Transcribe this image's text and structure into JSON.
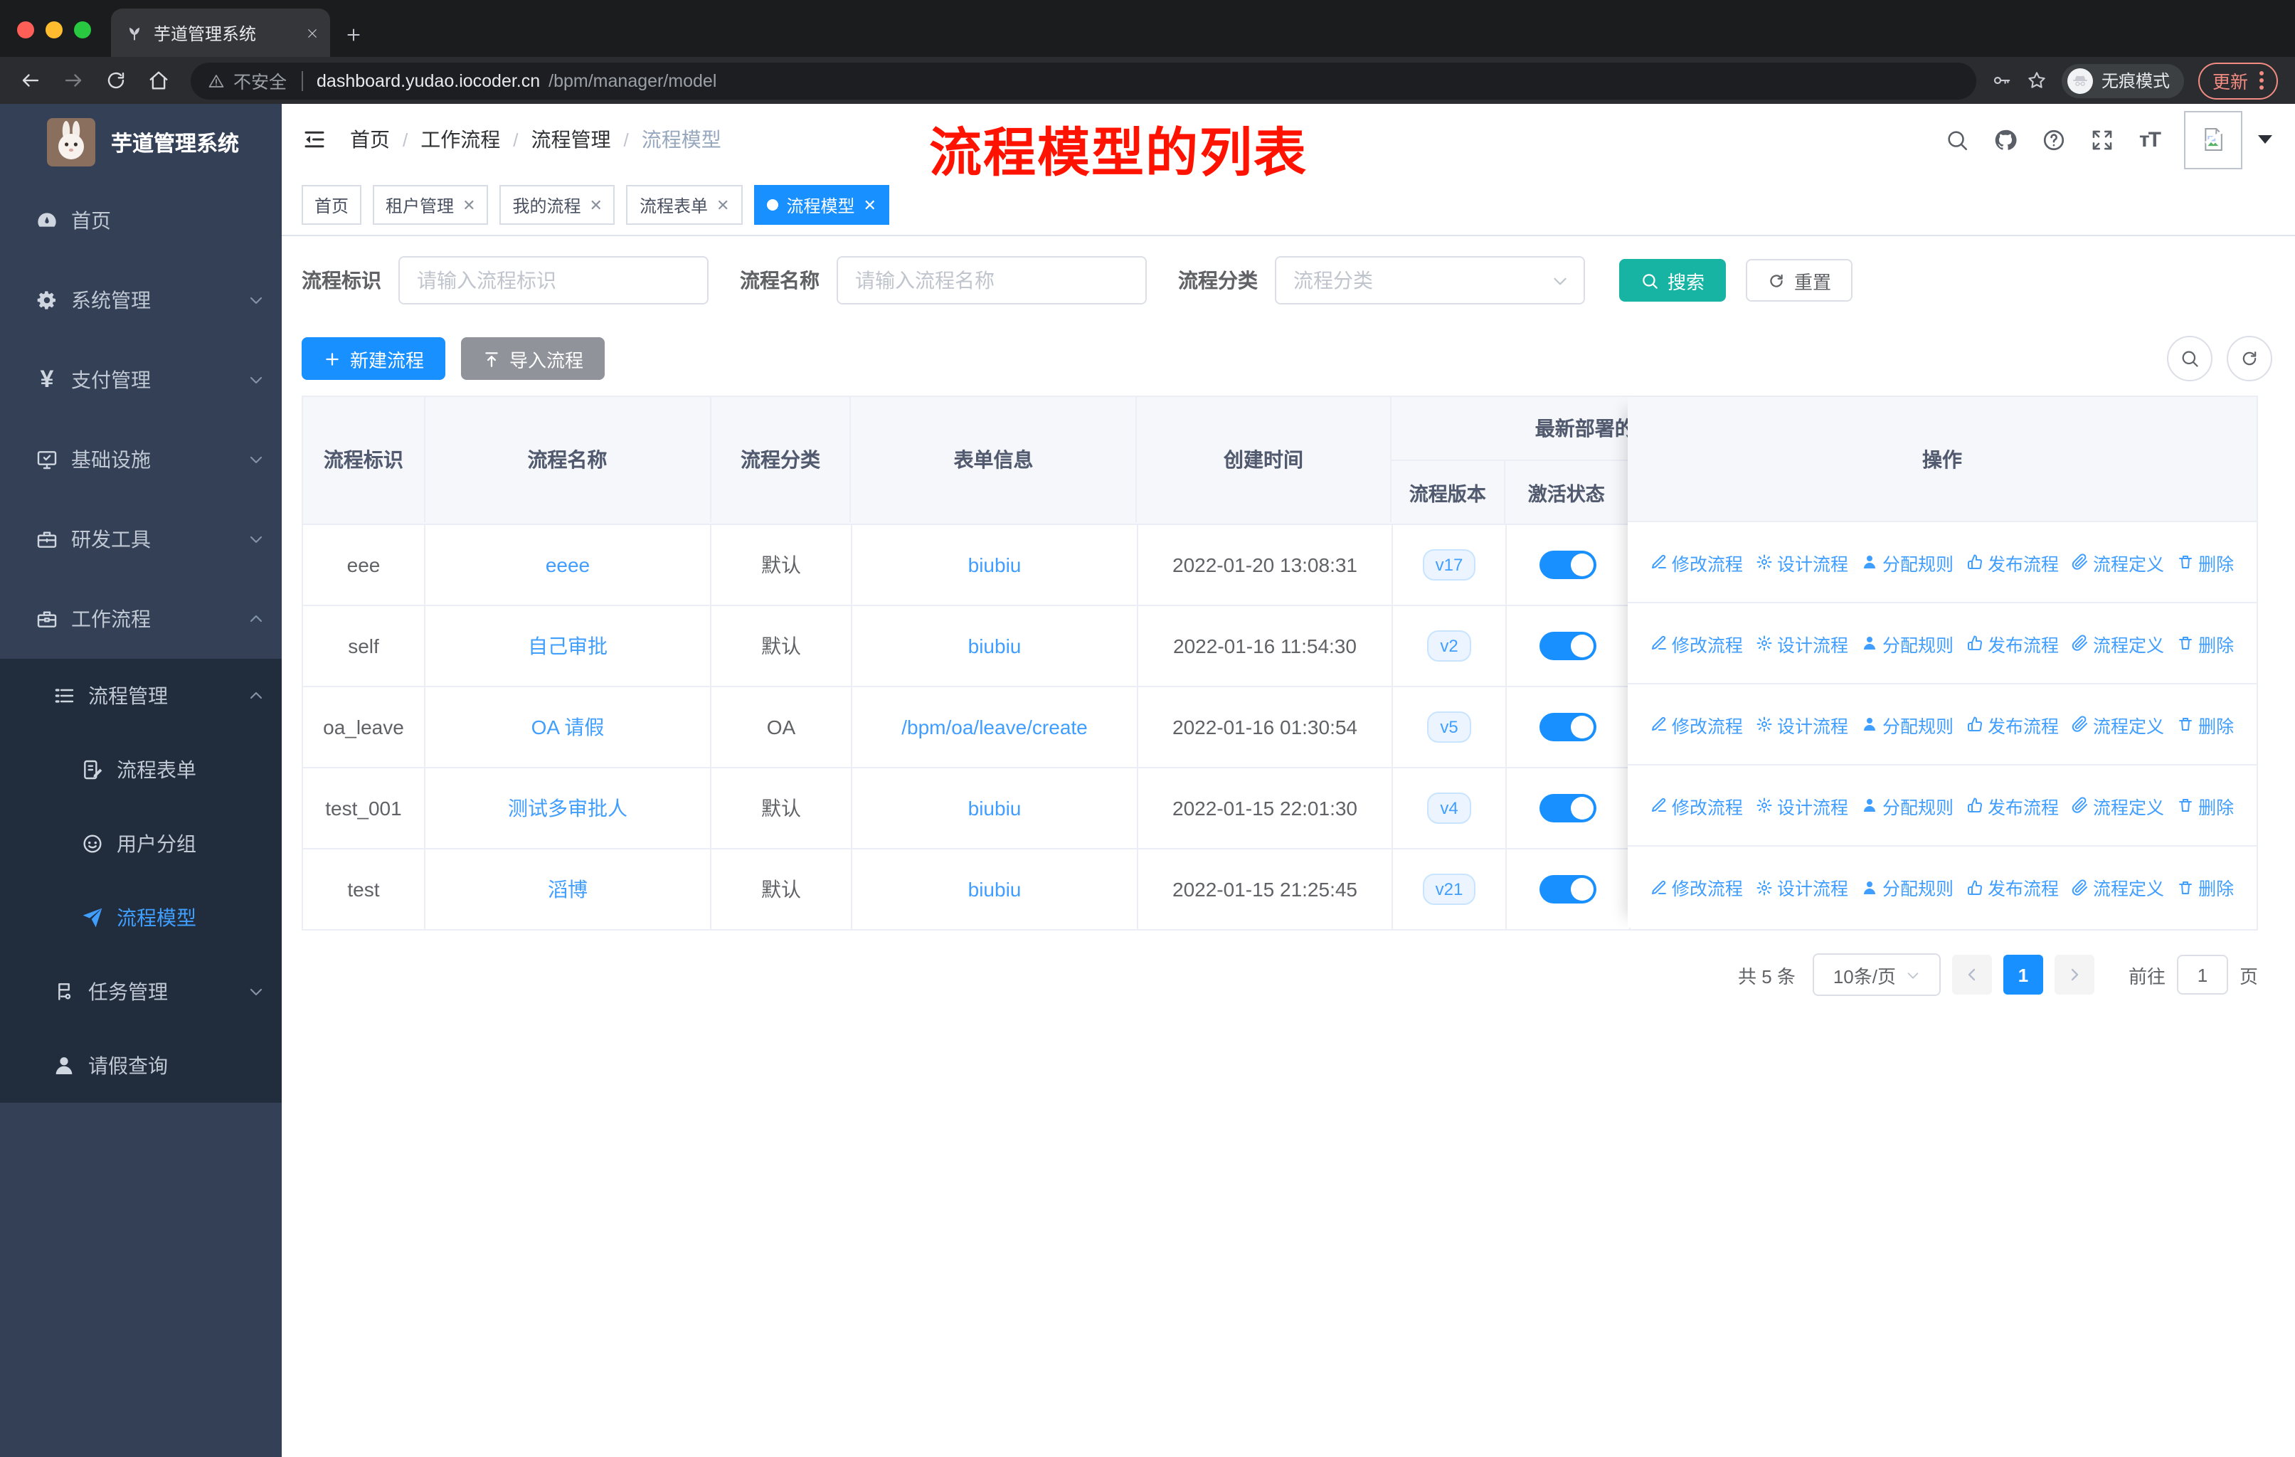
{
  "browser": {
    "tab_title": "芋道管理系统",
    "security": "不安全",
    "url_host": "dashboard.yudao.iocoder.cn",
    "url_path": "/bpm/manager/model",
    "incognito": "无痕模式",
    "update": "更新"
  },
  "sidebar": {
    "app_title": "芋道管理系统",
    "items": [
      {
        "label": "首页",
        "icon": "dashboard-icon"
      },
      {
        "label": "系统管理",
        "icon": "gear-icon",
        "expandable": true
      },
      {
        "label": "支付管理",
        "icon": "yen-icon",
        "expandable": true
      },
      {
        "label": "基础设施",
        "icon": "monitor-icon",
        "expandable": true
      },
      {
        "label": "研发工具",
        "icon": "toolbox-icon",
        "expandable": true
      },
      {
        "label": "工作流程",
        "icon": "briefcase-icon",
        "expandable": true,
        "expanded": true
      },
      {
        "label": "流程管理",
        "icon": "flow-list-icon",
        "expanded": true,
        "level": 2
      },
      {
        "label": "流程表单",
        "icon": "form-doc-icon",
        "level": 3
      },
      {
        "label": "用户分组",
        "icon": "user-group-icon",
        "level": 3
      },
      {
        "label": "流程模型",
        "icon": "paper-plane-icon",
        "level": 3,
        "active": true
      },
      {
        "label": "任务管理",
        "icon": "task-icon",
        "expandable": true,
        "level": 2
      },
      {
        "label": "请假查询",
        "icon": "person-icon",
        "level": 2
      }
    ]
  },
  "navbar": {
    "breadcrumb": [
      "首页",
      "工作流程",
      "流程管理",
      "流程模型"
    ],
    "annotation": "流程模型的列表"
  },
  "tags": [
    {
      "label": "首页"
    },
    {
      "label": "租户管理"
    },
    {
      "label": "我的流程"
    },
    {
      "label": "流程表单"
    },
    {
      "label": "流程模型"
    }
  ],
  "filters": {
    "id_label": "流程标识",
    "id_placeholder": "请输入流程标识",
    "name_label": "流程名称",
    "name_placeholder": "请输入流程名称",
    "category_label": "流程分类",
    "category_placeholder": "流程分类",
    "search_label": "搜索",
    "reset_label": "重置"
  },
  "toolbar": {
    "create_label": "新建流程",
    "import_label": "导入流程"
  },
  "table": {
    "columns": [
      "流程标识",
      "流程名称",
      "流程分类",
      "表单信息",
      "创建时间"
    ],
    "group_header": "最新部署的",
    "sub_columns": [
      "流程版本",
      "激活状态"
    ],
    "actions_header": "操作",
    "actions": [
      "修改流程",
      "设计流程",
      "分配规则",
      "发布流程",
      "流程定义",
      "删除"
    ],
    "rows": [
      {
        "id": "eee",
        "name": "eeee",
        "category": "默认",
        "form": "biubiu",
        "created": "2022-01-20 13:08:31",
        "version": "v17",
        "active": true
      },
      {
        "id": "self",
        "name": "自己审批",
        "category": "默认",
        "form": "biubiu",
        "created": "2022-01-16 11:54:30",
        "version": "v2",
        "active": true
      },
      {
        "id": "oa_leave",
        "name": "OA 请假",
        "category": "OA",
        "form": "/bpm/oa/leave/create",
        "created": "2022-01-16 01:30:54",
        "version": "v5",
        "active": true
      },
      {
        "id": "test_001",
        "name": "测试多审批人",
        "category": "默认",
        "form": "biubiu",
        "created": "2022-01-15 22:01:30",
        "version": "v4",
        "active": true
      },
      {
        "id": "test",
        "name": "滔博",
        "category": "默认",
        "form": "biubiu",
        "created": "2022-01-15 21:25:45",
        "version": "v21",
        "active": true
      }
    ]
  },
  "pagination": {
    "total": "共 5 条",
    "page_size": "10条/页",
    "current": "1",
    "goto_label": "前往",
    "goto_value": "1",
    "page_unit": "页"
  },
  "colors": {
    "primary": "#1890ff",
    "link": "#409eff",
    "search_teal": "#17b3a3",
    "sidebar_bg": "#334056",
    "submenu_bg": "#212d3d",
    "annotation_red": "#ff1200",
    "update_pill": "#f28b82"
  },
  "icons": {
    "traffic_lights": "red-yellow-green",
    "tab_favicon": "plant-icon",
    "url_warning": "warning-triangle-icon",
    "toolbar": [
      "back-icon",
      "forward-icon",
      "reload-icon",
      "home-icon",
      "key-icon",
      "star-icon",
      "incognito-icon",
      "more-dots-icon"
    ],
    "navbar": [
      "hamburger-icon",
      "search-icon",
      "github-icon",
      "question-icon",
      "fullscreen-icon",
      "font-size-icon",
      "broken-image-icon"
    ],
    "row_actions": [
      "pencil-icon",
      "gear-icon",
      "user-icon",
      "thumb-icon",
      "paperclip-icon",
      "trash-icon"
    ]
  }
}
